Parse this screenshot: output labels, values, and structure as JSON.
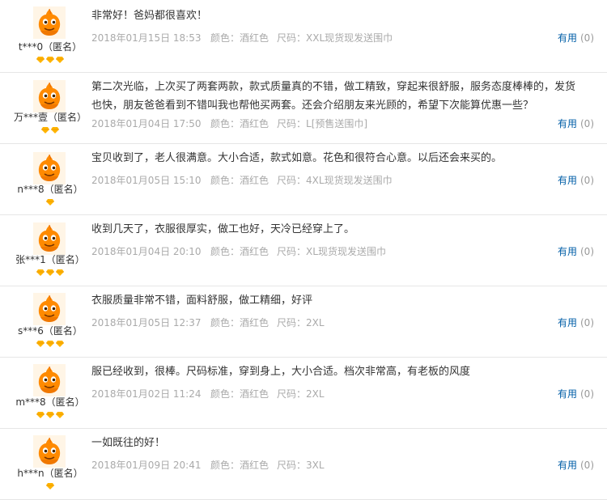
{
  "colors": {
    "accent_link": "#005ea7",
    "meta_gray": "#aaaaaa",
    "avatar_orange": "#ff8a00",
    "badge_gold": "#ffb400"
  },
  "reviews": [
    {
      "user": "t***0（匿名）",
      "badges": 3,
      "text": "非常好！爸妈都很喜欢！",
      "date": "2018年01月15日 18:53",
      "color_label": "颜色：",
      "color": "酒红色",
      "size_label": "尺码：",
      "size": "XXL现货现发送围巾",
      "useful": "有用",
      "count": "(0)"
    },
    {
      "user": "万***壹（匿名）",
      "badges": 2,
      "text": "第二次光临，上次买了两套两款，款式质量真的不错，做工精致，穿起来很舒服，服务态度棒棒的，发货也快，朋友爸爸看到不错叫我也帮他买两套。还会介绍朋友来光顾的，希望下次能算优惠一些？",
      "date": "2018年01月04日 17:50",
      "color_label": "颜色：",
      "color": "酒红色",
      "size_label": "尺码：",
      "size": "L[预售送围巾]",
      "useful": "有用",
      "count": "(0)"
    },
    {
      "user": "n***8（匿名）",
      "badges": 1,
      "text": "宝贝收到了，老人很满意。大小合适，款式如意。花色和很符合心意。以后还会来买的。",
      "date": "2018年01月05日 15:10",
      "color_label": "颜色：",
      "color": "酒红色",
      "size_label": "尺码：",
      "size": "4XL现货现发送围巾",
      "useful": "有用",
      "count": "(0)"
    },
    {
      "user": "张***1（匿名）",
      "badges": 3,
      "text": "收到几天了，衣服很厚实，做工也好，天冷已经穿上了。",
      "date": "2018年01月04日 20:10",
      "color_label": "颜色：",
      "color": "酒红色",
      "size_label": "尺码：",
      "size": "XL现货现发送围巾",
      "useful": "有用",
      "count": "(0)"
    },
    {
      "user": "s***6（匿名）",
      "badges": 3,
      "text": "衣服质量非常不错，面料舒服，做工精细，好评",
      "date": "2018年01月05日 12:37",
      "color_label": "颜色：",
      "color": "酒红色",
      "size_label": "尺码：",
      "size": "2XL",
      "useful": "有用",
      "count": "(0)"
    },
    {
      "user": "m***8（匿名）",
      "badges": 3,
      "text": "服已经收到，很棒。尺码标准，穿到身上，大小合适。档次非常高，有老板的风度",
      "date": "2018年01月02日 11:24",
      "color_label": "颜色：",
      "color": "酒红色",
      "size_label": "尺码：",
      "size": "2XL",
      "useful": "有用",
      "count": "(0)"
    },
    {
      "user": "h***n（匿名）",
      "badges": 1,
      "text": "一如既往的好！",
      "date": "2018年01月09日 20:41",
      "color_label": "颜色：",
      "color": "酒红色",
      "size_label": "尺码：",
      "size": "3XL",
      "useful": "有用",
      "count": "(0)"
    }
  ]
}
